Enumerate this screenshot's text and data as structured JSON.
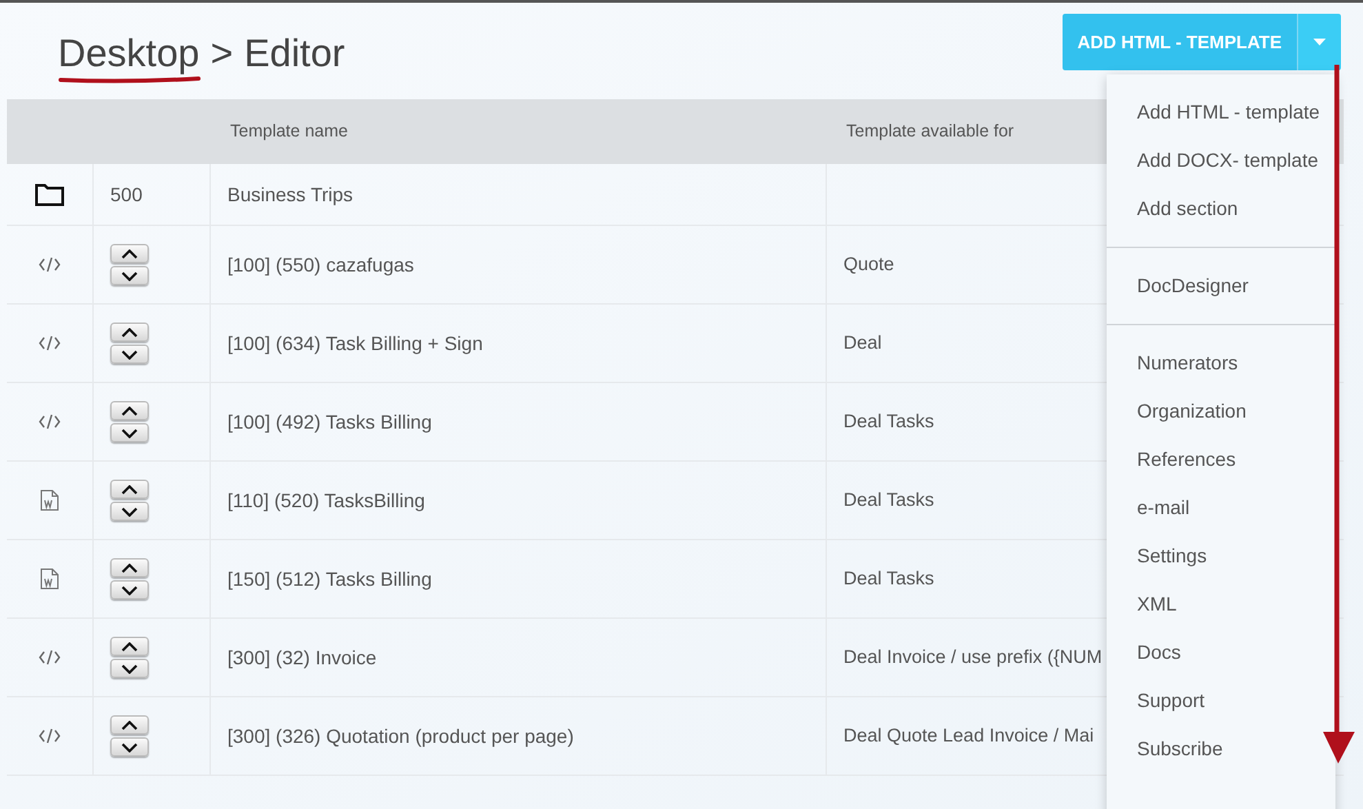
{
  "breadcrumb": {
    "items": [
      "Desktop",
      "Editor"
    ],
    "separator": ">"
  },
  "add_button": {
    "label": "ADD HTML - TEMPLATE",
    "menu_open": true
  },
  "table": {
    "columns": [
      "Template name",
      "Template available for"
    ],
    "rows": [
      {
        "kind": "folder",
        "number": "500",
        "name": "Business Trips",
        "available_for": ""
      },
      {
        "kind": "html",
        "name": "[100] (550) cazafugas",
        "available_for": "Quote"
      },
      {
        "kind": "html",
        "name": "[100] (634) Task Billing + Sign",
        "available_for": "Deal"
      },
      {
        "kind": "html",
        "name": "[100] (492) Tasks Billing",
        "available_for": "Deal Tasks"
      },
      {
        "kind": "docx",
        "name": "[110] (520) TasksBilling",
        "available_for": "Deal Tasks"
      },
      {
        "kind": "docx",
        "name": "[150] (512) Tasks Billing",
        "available_for": "Deal Tasks"
      },
      {
        "kind": "html",
        "name": "[300] (32) Invoice",
        "available_for": "Deal Invoice / use prefix ({NUM"
      },
      {
        "kind": "html",
        "name": "[300] (326) Quotation (product per page)",
        "available_for": "Deal Quote Lead Invoice / Mai"
      }
    ]
  },
  "menu": {
    "groups": [
      [
        "Add HTML - template",
        "Add DOCX- template",
        "Add section"
      ],
      [
        "DocDesigner"
      ],
      [
        "Numerators",
        "Organization",
        "References",
        "e-mail",
        "Settings",
        "XML",
        "Docs",
        "Support",
        "Subscribe"
      ]
    ]
  }
}
